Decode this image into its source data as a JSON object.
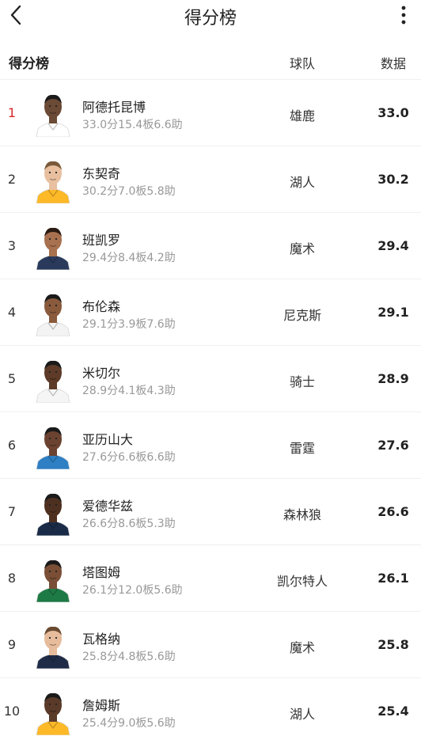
{
  "header": {
    "title": "得分榜"
  },
  "table": {
    "label": "得分榜",
    "col_team": "球队",
    "col_data": "数据"
  },
  "colors": {
    "rank_highlight": "#d62a2a"
  },
  "players": [
    {
      "rank": "1",
      "name": "阿德托昆博",
      "stats": "33.0分15.4板6.6助",
      "team": "雄鹿",
      "value": "33.0",
      "skin": "#6b4a36",
      "jersey": "#ffffff",
      "hair": "#1a1a1a"
    },
    {
      "rank": "2",
      "name": "东契奇",
      "stats": "30.2分7.0板5.8助",
      "team": "湖人",
      "value": "30.2",
      "skin": "#e8c0a0",
      "jersey": "#fdb927",
      "hair": "#7a5a3a"
    },
    {
      "rank": "3",
      "name": "班凯罗",
      "stats": "29.4分8.4板4.2助",
      "team": "魔术",
      "value": "29.4",
      "skin": "#a8714f",
      "jersey": "#2a3a5c",
      "hair": "#2a1a12"
    },
    {
      "rank": "4",
      "name": "布伦森",
      "stats": "29.1分3.9板7.6助",
      "team": "尼克斯",
      "value": "29.1",
      "skin": "#8a5a3c",
      "jersey": "#f3f3f3",
      "hair": "#1a1a1a"
    },
    {
      "rank": "5",
      "name": "米切尔",
      "stats": "28.9分4.1板4.3助",
      "team": "骑士",
      "value": "28.9",
      "skin": "#5d3b28",
      "jersey": "#f5f5f5",
      "hair": "#1a1a1a"
    },
    {
      "rank": "6",
      "name": "亚历山大",
      "stats": "27.6分6.6板6.6助",
      "team": "雷霆",
      "value": "27.6",
      "skin": "#6b4330",
      "jersey": "#2e7fc4",
      "hair": "#1a1a1a"
    },
    {
      "rank": "7",
      "name": "爱德华兹",
      "stats": "26.6分8.6板5.3助",
      "team": "森林狼",
      "value": "26.6",
      "skin": "#4e3020",
      "jersey": "#1a2b48",
      "hair": "#1a1a1a"
    },
    {
      "rank": "8",
      "name": "塔图姆",
      "stats": "26.1分12.0板5.6助",
      "team": "凯尔特人",
      "value": "26.1",
      "skin": "#7a4f36",
      "jersey": "#1e7a45",
      "hair": "#1a1a1a"
    },
    {
      "rank": "9",
      "name": "瓦格纳",
      "stats": "25.8分4.8板5.6助",
      "team": "魔术",
      "value": "25.8",
      "skin": "#e6bc9c",
      "jersey": "#1f2b47",
      "hair": "#6a4a30"
    },
    {
      "rank": "10",
      "name": "詹姆斯",
      "stats": "25.4分9.0板5.6助",
      "team": "湖人",
      "value": "25.4",
      "skin": "#5a3a28",
      "jersey": "#fdb927",
      "hair": "#1a1a1a"
    }
  ]
}
